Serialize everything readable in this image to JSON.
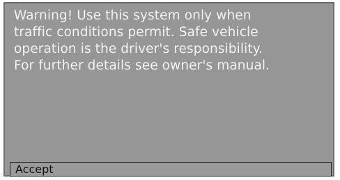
{
  "dialog": {
    "message": "Warning! Use this system only when\ntraffic conditions permit. Safe vehicle\noperation is the driver's responsibility.\nFor further details see owner's manual.",
    "accept_label": "Accept"
  },
  "colors": {
    "panel_background": "#969696",
    "text": "#f2f2f2",
    "button_border": "#222222"
  }
}
